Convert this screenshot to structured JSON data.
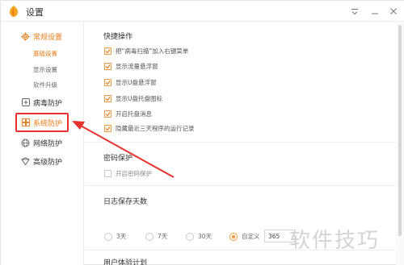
{
  "window": {
    "title": "设置"
  },
  "sidebar": {
    "general": {
      "label": "常规设置",
      "icon": "gear-icon"
    },
    "general_sub": [
      "基础设置",
      "显示设置",
      "软件升级"
    ],
    "virus": {
      "label": "病毒防护",
      "icon": "plus-square-icon"
    },
    "system": {
      "label": "系统防护",
      "icon": "system-grid-icon"
    },
    "network": {
      "label": "网络防护",
      "icon": "globe-icon"
    },
    "advanced": {
      "label": "高级防护",
      "icon": "shield-icon"
    }
  },
  "quick_ops": {
    "title": "快捷操作",
    "items": [
      {
        "label": "把“病毒扫描”加入右键菜单",
        "checked": true
      },
      {
        "label": "显示流量悬浮窗",
        "checked": true
      },
      {
        "label": "显示U盘悬浮窗",
        "checked": true
      },
      {
        "label": "显示U盘托盘图标",
        "checked": true
      },
      {
        "label": "开启托盘消息",
        "checked": true
      },
      {
        "label": "隐藏最近三天程序的运行记录",
        "checked": true
      }
    ]
  },
  "password": {
    "title": "密码保护",
    "enable_label": "开启密码保护",
    "checked": false
  },
  "log_days": {
    "title": "日志保存天数",
    "options": [
      "3天",
      "7天",
      "30天",
      "自定义"
    ],
    "selected": "自定义",
    "custom_value": "365"
  },
  "experience": {
    "title": "用户体验计划"
  },
  "watermark": "软件技巧",
  "colors": {
    "accent": "#f07a16",
    "highlight": "#e8322e"
  }
}
